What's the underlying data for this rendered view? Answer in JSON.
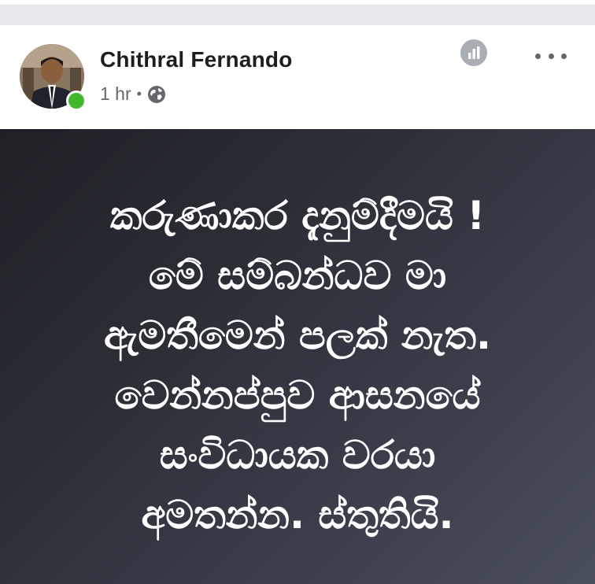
{
  "post": {
    "author": "Chithral Fernando",
    "time": "1 hr",
    "separator": "•",
    "privacy_icon": "globe-icon",
    "insights_icon": "bar-chart-icon",
    "menu_icon": "more-horizontal-icon",
    "online_status_color": "#42b72a",
    "body_lines": [
      "කරුණාකර දැනුම්දීමයි !",
      "මේ සම්බන්ධව මා",
      "ඇමතීමෙන් පලක් නැත.",
      "වෙන්නප්පුව ආසනයේ",
      "සංවිධායක වරයා",
      "අමතන්න. ස්තුතියි."
    ]
  }
}
